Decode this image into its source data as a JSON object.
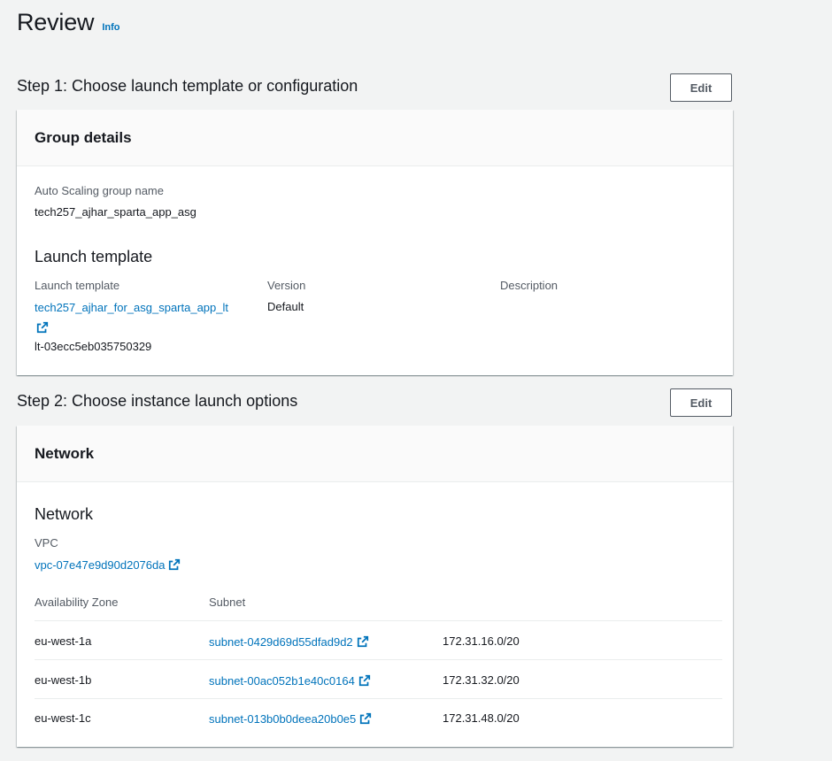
{
  "header": {
    "title": "Review",
    "info_label": "Info"
  },
  "step1": {
    "title": "Step 1: Choose launch template or configuration",
    "edit_label": "Edit",
    "card_title": "Group details",
    "asg_name_label": "Auto Scaling group name",
    "asg_name_value": "tech257_ajhar_sparta_app_asg",
    "launch_template_heading": "Launch template",
    "columns": {
      "launch_template": "Launch template",
      "version": "Version",
      "description": "Description"
    },
    "launch_template_name": "tech257_ajhar_for_asg_sparta_app_lt",
    "launch_template_id": "lt-03ecc5eb035750329",
    "version_value": "Default",
    "description_value": ""
  },
  "step2": {
    "title": "Step 2: Choose instance launch options",
    "edit_label": "Edit",
    "card_title": "Network",
    "network_heading": "Network",
    "vpc_label": "VPC",
    "vpc_value": "vpc-07e47e9d90d2076da",
    "table": {
      "headers": [
        "Availability Zone",
        "Subnet"
      ],
      "rows": [
        {
          "zone": "eu-west-1a",
          "subnet": "subnet-0429d69d55dfad9d2",
          "cidr": "172.31.16.0/20"
        },
        {
          "zone": "eu-west-1b",
          "subnet": "subnet-00ac052b1e40c0164",
          "cidr": "172.31.32.0/20"
        },
        {
          "zone": "eu-west-1c",
          "subnet": "subnet-013b0b0deea20b0e5",
          "cidr": "172.31.48.0/20"
        }
      ]
    }
  },
  "colors": {
    "link": "#0073bb",
    "text": "#16191f",
    "label": "#545b64",
    "background": "#f2f3f3"
  },
  "icons": {
    "external_link": "external-link-icon"
  }
}
